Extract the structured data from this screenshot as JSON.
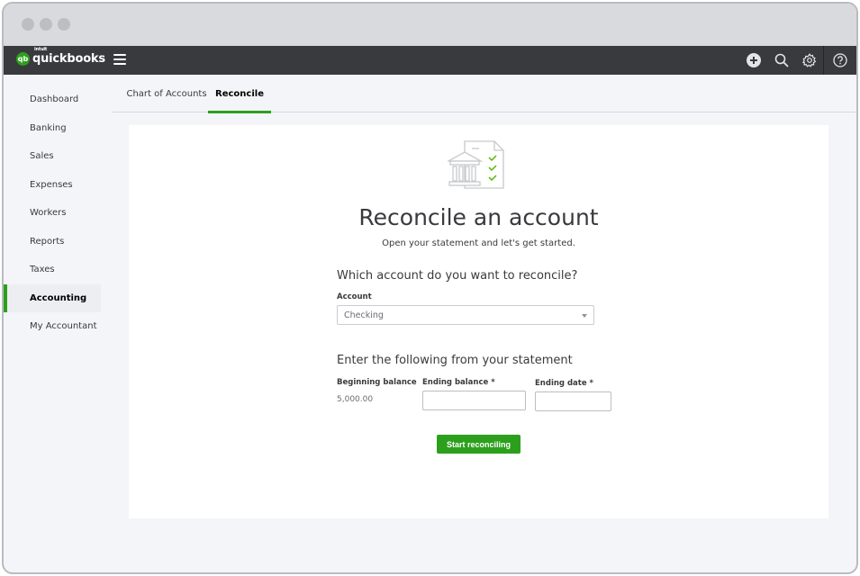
{
  "window": {
    "controls": [
      "close",
      "minimize",
      "maximize"
    ]
  },
  "topnav": {
    "logo_small": "intuit",
    "logo_text": "quickbooks",
    "logo_badge": "qb",
    "icons": [
      "plus-icon",
      "search-icon",
      "gear-icon",
      "help-icon"
    ]
  },
  "sidebar": {
    "items": [
      {
        "label": "Dashboard"
      },
      {
        "label": "Banking"
      },
      {
        "label": "Sales"
      },
      {
        "label": "Expenses"
      },
      {
        "label": "Workers"
      },
      {
        "label": "Reports"
      },
      {
        "label": "Taxes"
      },
      {
        "label": "Accounting",
        "active": true
      },
      {
        "label": "My Accountant"
      }
    ]
  },
  "tabs": [
    {
      "label": "Chart of Accounts"
    },
    {
      "label": "Reconcile",
      "active": true
    }
  ],
  "main": {
    "title": "Reconcile an account",
    "subtitle": "Open your statement and let's get started.",
    "account_section": {
      "heading": "Which account do you want to reconcile?",
      "account_label": "Account",
      "account_value": "Checking"
    },
    "statement_section": {
      "heading": "Enter the following from your statement",
      "beginning_balance_label": "Beginning balance",
      "beginning_balance_value": "5,000.00",
      "ending_balance_label": "Ending balance *",
      "ending_balance_value": "",
      "ending_date_label": "Ending date *",
      "ending_date_value": ""
    },
    "start_button": "Start reconciling"
  },
  "colors": {
    "brand_green": "#2ca01c",
    "nav_dark": "#393a3d"
  }
}
